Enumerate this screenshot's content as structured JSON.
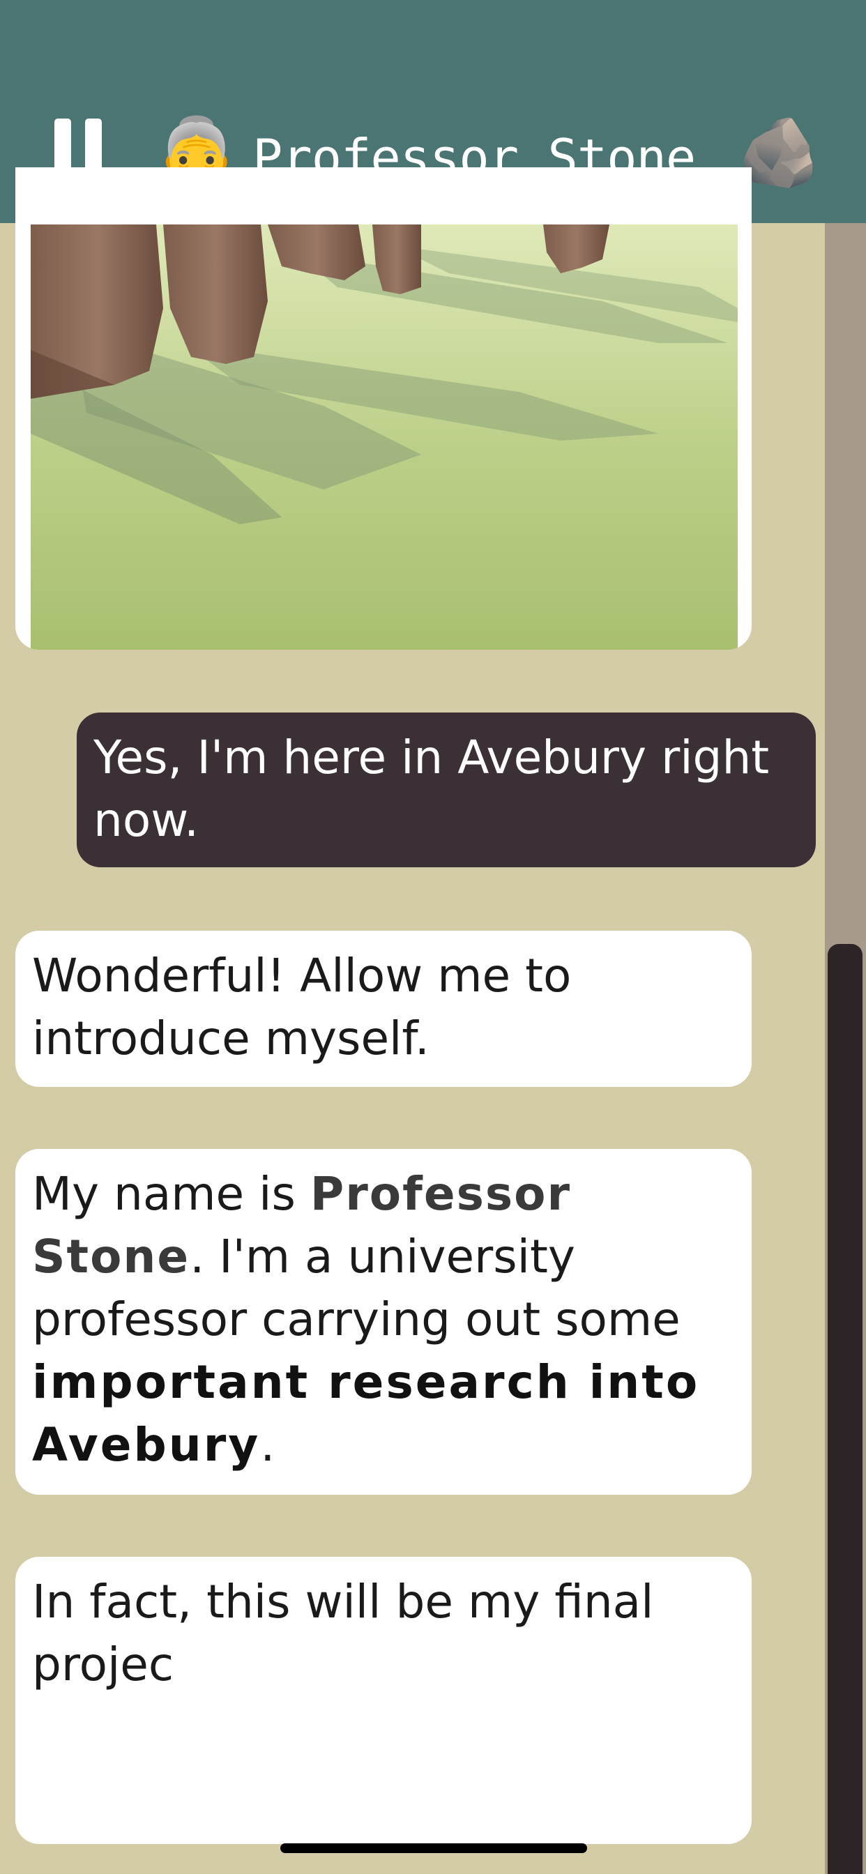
{
  "header": {
    "avatar_emoji": "👵",
    "title": "Professor Stone",
    "rock_emoji": "🪨",
    "pause_icon": "pause-icon",
    "background": "#4b7572"
  },
  "messages": {
    "user_reply": "Yes, I'm here in Avebury right now.",
    "msg1": "Wonderful! Allow me to introduce myself.",
    "msg2": {
      "part1": "My name is ",
      "name": "Professor Stone",
      "part2": ". I'm a university professor carrying out some ",
      "bold": "important research into Avebury",
      "part3": "."
    },
    "msg3": "In fact, this will be my final projec"
  },
  "scene_image": "standing-stones-illustration",
  "colors": {
    "background": "#d3cca6",
    "user_bubble": "#3b3035",
    "bot_bubble": "#ffffff",
    "scroll_thumb": "#2c2427"
  }
}
